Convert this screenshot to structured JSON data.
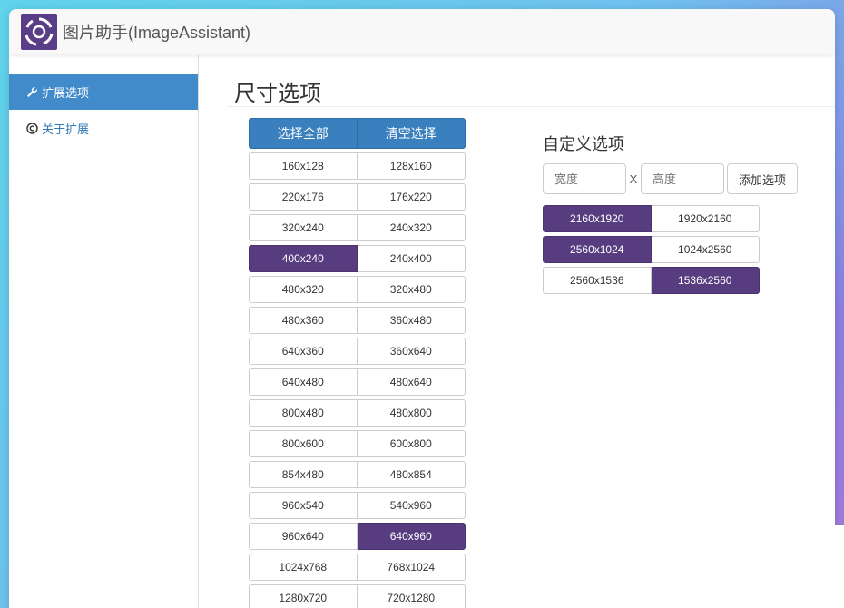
{
  "app": {
    "title": "图片助手(ImageAssistant)",
    "logo_icon": "aperture-logo-icon"
  },
  "sidebar": {
    "items": [
      {
        "label": "扩展选项",
        "icon": "wrench-icon",
        "active": true
      },
      {
        "label": "关于扩展",
        "icon": "copyright-icon",
        "active": false
      }
    ]
  },
  "main": {
    "title": "尺寸选项",
    "grid_head": {
      "select_all": "选择全部",
      "clear": "清空选择"
    },
    "sizes": [
      {
        "a": "160x128",
        "b": "128x160"
      },
      {
        "a": "220x176",
        "b": "176x220"
      },
      {
        "a": "320x240",
        "b": "240x320"
      },
      {
        "a": "400x240",
        "b": "240x400"
      },
      {
        "a": "480x320",
        "b": "320x480"
      },
      {
        "a": "480x360",
        "b": "360x480"
      },
      {
        "a": "640x360",
        "b": "360x640"
      },
      {
        "a": "640x480",
        "b": "480x640"
      },
      {
        "a": "800x480",
        "b": "480x800"
      },
      {
        "a": "800x600",
        "b": "600x800"
      },
      {
        "a": "854x480",
        "b": "480x854"
      },
      {
        "a": "960x540",
        "b": "540x960"
      },
      {
        "a": "960x640",
        "b": "640x960"
      },
      {
        "a": "1024x768",
        "b": "768x1024"
      },
      {
        "a": "1280x720",
        "b": "720x1280"
      }
    ],
    "selected_sizes": [
      "400x240",
      "640x960"
    ]
  },
  "custom": {
    "title": "自定义选项",
    "width_placeholder": "宽度",
    "separator": "X",
    "height_placeholder": "高度",
    "add_label": "添加选项",
    "sizes": [
      {
        "a": "2160x1920",
        "b": "1920x2160"
      },
      {
        "a": "2560x1024",
        "b": "1024x2560"
      },
      {
        "a": "2560x1536",
        "b": "1536x2560"
      }
    ],
    "selected_sizes": [
      "2160x1920",
      "2560x1024",
      "1536x2560"
    ]
  },
  "colors": {
    "selected": "#573d7f",
    "primary": "#3a80bf",
    "nav_active": "#428bca"
  }
}
